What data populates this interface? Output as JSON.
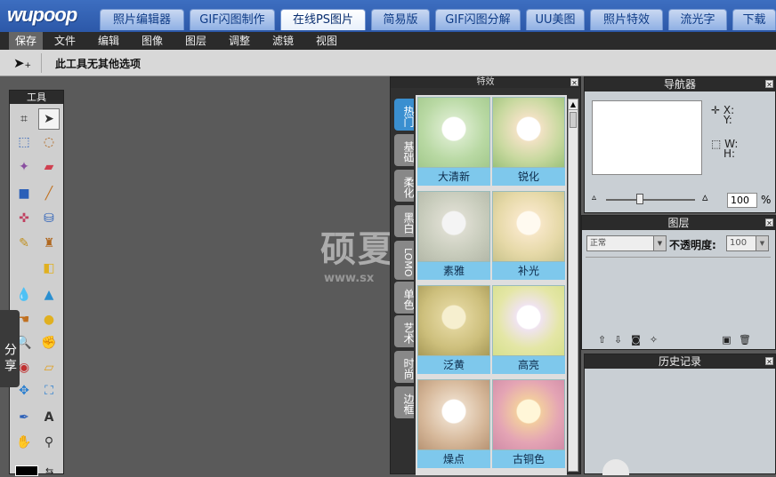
{
  "logo": "wupoop",
  "nav_tabs": [
    {
      "label": "照片编辑器"
    },
    {
      "label": "GIF闪图制作"
    },
    {
      "label": "在线PS图片"
    },
    {
      "label": "简易版"
    },
    {
      "label": "GIF闪图分解"
    },
    {
      "label": "UU美图"
    },
    {
      "label": "照片特效"
    },
    {
      "label": "流光字"
    },
    {
      "label": "下载"
    }
  ],
  "menu": [
    {
      "label": "保存"
    },
    {
      "label": "文件"
    },
    {
      "label": "编辑"
    },
    {
      "label": "图像"
    },
    {
      "label": "图层"
    },
    {
      "label": "调整"
    },
    {
      "label": "滤镜"
    },
    {
      "label": "视图"
    }
  ],
  "options_bar": {
    "text": "此工具无其他选项"
  },
  "toolbox": {
    "title": "工具"
  },
  "share": {
    "label": "分享"
  },
  "effects": {
    "title": "特效",
    "tabs": [
      {
        "label": "热门"
      },
      {
        "label": "基础"
      },
      {
        "label": "柔化"
      },
      {
        "label": "黑白"
      },
      {
        "label": "LOMO"
      },
      {
        "label": "单色"
      },
      {
        "label": "艺术"
      },
      {
        "label": "时尚"
      },
      {
        "label": "边框"
      }
    ],
    "thumbs": [
      {
        "label": "大清新"
      },
      {
        "label": "锐化"
      },
      {
        "label": "素雅"
      },
      {
        "label": "补光"
      },
      {
        "label": "泛黄"
      },
      {
        "label": "高亮"
      },
      {
        "label": "燥点"
      },
      {
        "label": "古铜色"
      }
    ]
  },
  "navigator": {
    "title": "导航器",
    "x_label": "X:",
    "y_label": "Y:",
    "w_label": "W:",
    "h_label": "H:",
    "zoom": "100",
    "zoom_unit": "%"
  },
  "layers": {
    "title": "图层",
    "blend_mode": "正常",
    "opacity_label": "不透明度:",
    "opacity_value": "100"
  },
  "history": {
    "title": "历史记录"
  },
  "watermark": {
    "text": "硕夏",
    "url": "www.sx"
  }
}
